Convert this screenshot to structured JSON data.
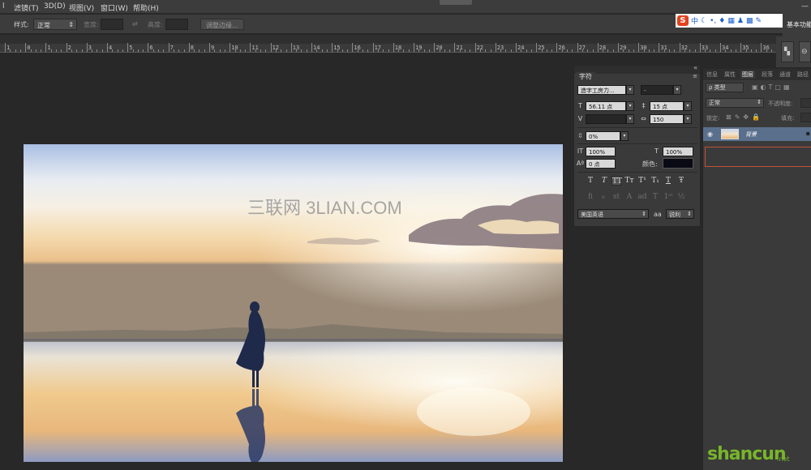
{
  "menu": [
    "滤镜(T)",
    "3D(D)",
    "视图(V)",
    "窗口(W)",
    "帮助(H)"
  ],
  "options": {
    "style_label": "样式:",
    "style_value": "正常",
    "width_label": "宽度:",
    "height_label": "高度:",
    "refine_button": "调整边缘..."
  },
  "sogou": {
    "logo": "S",
    "mode": "中"
  },
  "workspace_label": "基本功能",
  "ruler_ticks": [
    "1",
    "0",
    "1",
    "2",
    "3",
    "4",
    "5",
    "6",
    "7",
    "8",
    "9",
    "10",
    "11",
    "12",
    "13",
    "14",
    "15",
    "16",
    "17",
    "18",
    "19",
    "20",
    "21",
    "22",
    "23",
    "24",
    "25",
    "26",
    "27",
    "28",
    "29",
    "30",
    "31",
    "32",
    "33",
    "34",
    "35",
    "36"
  ],
  "photo": {
    "watermark": "三联网 3LIAN.COM"
  },
  "character": {
    "tab": "字符",
    "font_family": "造字工房力...",
    "font_style": "-",
    "font_size": "56.11 点",
    "leading": "15 点",
    "kerning": "",
    "tracking": "150",
    "scale_pct": "0%",
    "vscale": "100%",
    "hscale": "100%",
    "baseline": "0 点",
    "color_label": "颜色:",
    "language": "美国英语",
    "aa_label": "aa",
    "antialias": "锐利",
    "style_buttons": [
      "T",
      "T",
      "TT",
      "Tт",
      "T¹",
      "T₁",
      "T",
      "Ŧ"
    ],
    "ot_buttons": [
      "fi",
      "ℴ",
      "st",
      "A",
      "ad",
      "T",
      "1ˢᵗ",
      "½"
    ]
  },
  "layers": {
    "tabs": [
      "信息",
      "属性",
      "图层",
      "段落",
      "通道",
      "路径"
    ],
    "active_tab": "图层",
    "filter_label": "ρ 类型",
    "blend_mode": "正常",
    "opacity_label": "不透明度:",
    "lock_label": "锁定:",
    "fill_label": "填充:",
    "layer_name": "背景"
  },
  "site_watermark": {
    "brand": "shancun",
    "suffix": ".net"
  },
  "colors": {
    "accent_layer": "#5a6f8c",
    "sogou_red": "#e2421e",
    "watermark_green": "#77b52a"
  }
}
